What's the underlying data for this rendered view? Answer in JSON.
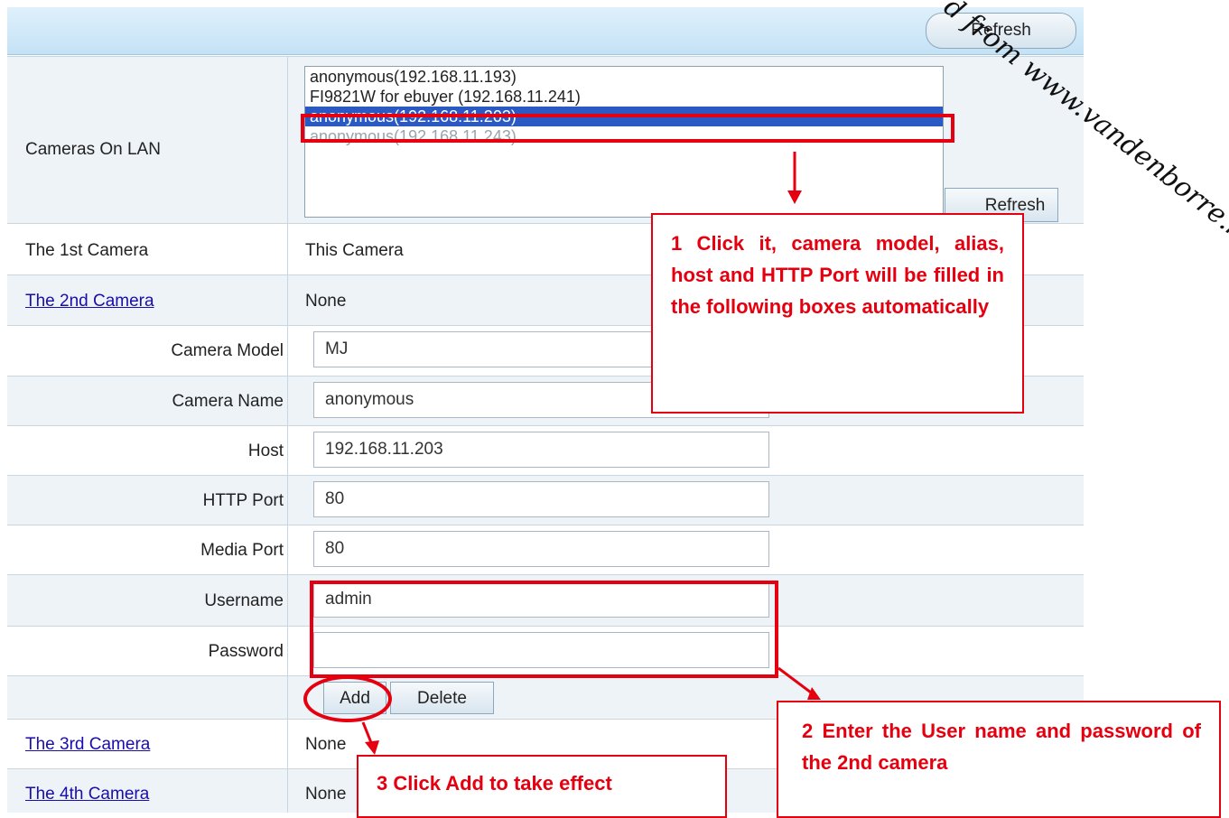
{
  "header": {
    "refresh_label": "Refresh"
  },
  "cameras_on_lan": {
    "label": "Cameras On LAN",
    "list": [
      "anonymous(192.168.11.193)",
      "FI9821W for ebuyer (192.168.11.241)",
      "anonymous(192.168.11.203)",
      "anonymous(192.168.11.243)"
    ],
    "refresh_label": "Refresh"
  },
  "first_camera": {
    "label": "The 1st Camera",
    "value": "This Camera"
  },
  "second_camera": {
    "label": "The 2nd Camera",
    "value": "None"
  },
  "form": {
    "camera_model": {
      "label": "Camera Model",
      "value": "MJ"
    },
    "camera_name": {
      "label": "Camera Name",
      "value": "anonymous"
    },
    "host": {
      "label": "Host",
      "value": "192.168.11.203"
    },
    "http_port": {
      "label": "HTTP Port",
      "value": "80"
    },
    "media_port": {
      "label": "Media Port",
      "value": "80"
    },
    "username": {
      "label": "Username",
      "value": "admin"
    },
    "password": {
      "label": "Password",
      "value": ""
    },
    "add_label": "Add",
    "delete_label": "Delete"
  },
  "third_camera": {
    "label": "The 3rd Camera",
    "value": "None"
  },
  "fourth_camera": {
    "label": "The 4th Camera",
    "value": "None"
  },
  "callouts": {
    "one": "1 Click it, camera model, alias, host and HTTP Port will be filled in the following boxes automatically",
    "two": "2 Enter the User name and password of the 2nd camera",
    "three": "3 Click Add to take effect"
  },
  "watermark": "d from www.vandenborre.be",
  "colors": {
    "accent_red": "#e6000f",
    "selection": "#2b59c3",
    "link": "#1a0dab"
  }
}
